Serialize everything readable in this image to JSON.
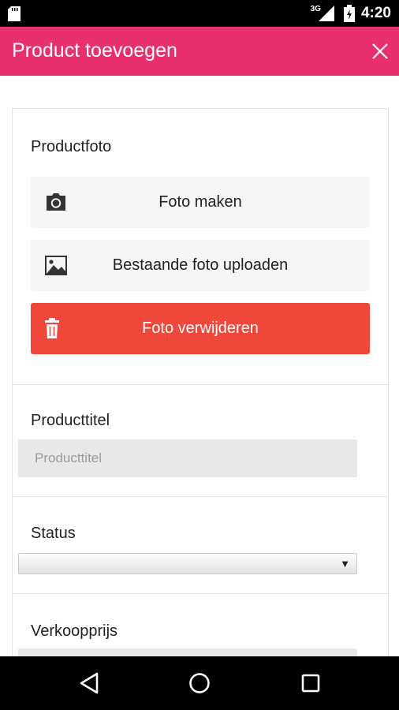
{
  "status_bar": {
    "network": "3G",
    "time": "4:20",
    "icons": [
      "sd-card-icon",
      "signal-icon",
      "battery-icon"
    ]
  },
  "app_bar": {
    "title": "Product toevoegen",
    "close_icon": "close-icon",
    "background": "#e8306f"
  },
  "photo_section": {
    "label": "Productfoto",
    "take_photo": {
      "label": "Foto maken",
      "icon": "camera-icon"
    },
    "upload_photo": {
      "label": "Bestaande foto uploaden",
      "icon": "image-icon"
    },
    "delete_photo": {
      "label": "Foto verwijderen",
      "icon": "trash-icon",
      "color": "#f0473b"
    }
  },
  "title_section": {
    "label": "Producttitel",
    "placeholder": "Producttitel",
    "value": ""
  },
  "status_section": {
    "label": "Status",
    "selected": ""
  },
  "price_section": {
    "label": "Verkoopprijs"
  },
  "nav_bar": {
    "icons": [
      "back-icon",
      "home-icon",
      "recents-icon"
    ]
  }
}
